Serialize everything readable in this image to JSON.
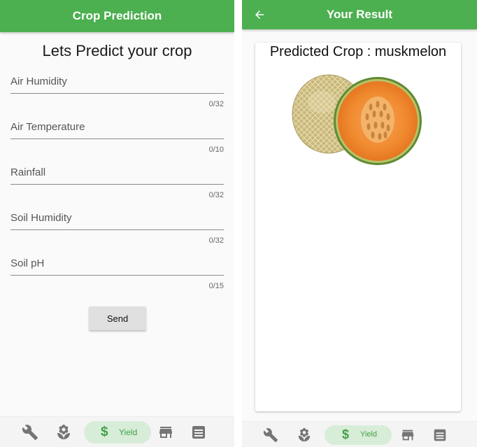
{
  "left_screen": {
    "appbar_title": "Crop Prediction",
    "page_title": "Lets Predict your crop",
    "fields": [
      {
        "label": "Air Humidity",
        "counter": "0/32"
      },
      {
        "label": "Air Temperature",
        "counter": "0/10"
      },
      {
        "label": "Rainfall",
        "counter": "0/32"
      },
      {
        "label": "Soil Humidity",
        "counter": "0/32"
      },
      {
        "label": "Soil pH",
        "counter": "0/15"
      }
    ],
    "send_label": "Send"
  },
  "right_screen": {
    "appbar_title": "Your Result",
    "back_icon": "arrow-back-icon",
    "result_text": "Predicted Crop : muskmelon",
    "image_subject": "muskmelon-cantaloupe"
  },
  "bottom_nav": {
    "items": [
      {
        "icon": "wrench-icon"
      },
      {
        "icon": "sprout-icon"
      },
      {
        "icon": "dollar-icon",
        "label": "Yield",
        "active": true
      },
      {
        "icon": "store-icon"
      },
      {
        "icon": "newspaper-icon"
      }
    ],
    "symbol": "$"
  },
  "colors": {
    "primary": "#4caf50",
    "active_pill": "#d7edd8",
    "active_text": "#43a047",
    "icon_gray": "#757575"
  }
}
